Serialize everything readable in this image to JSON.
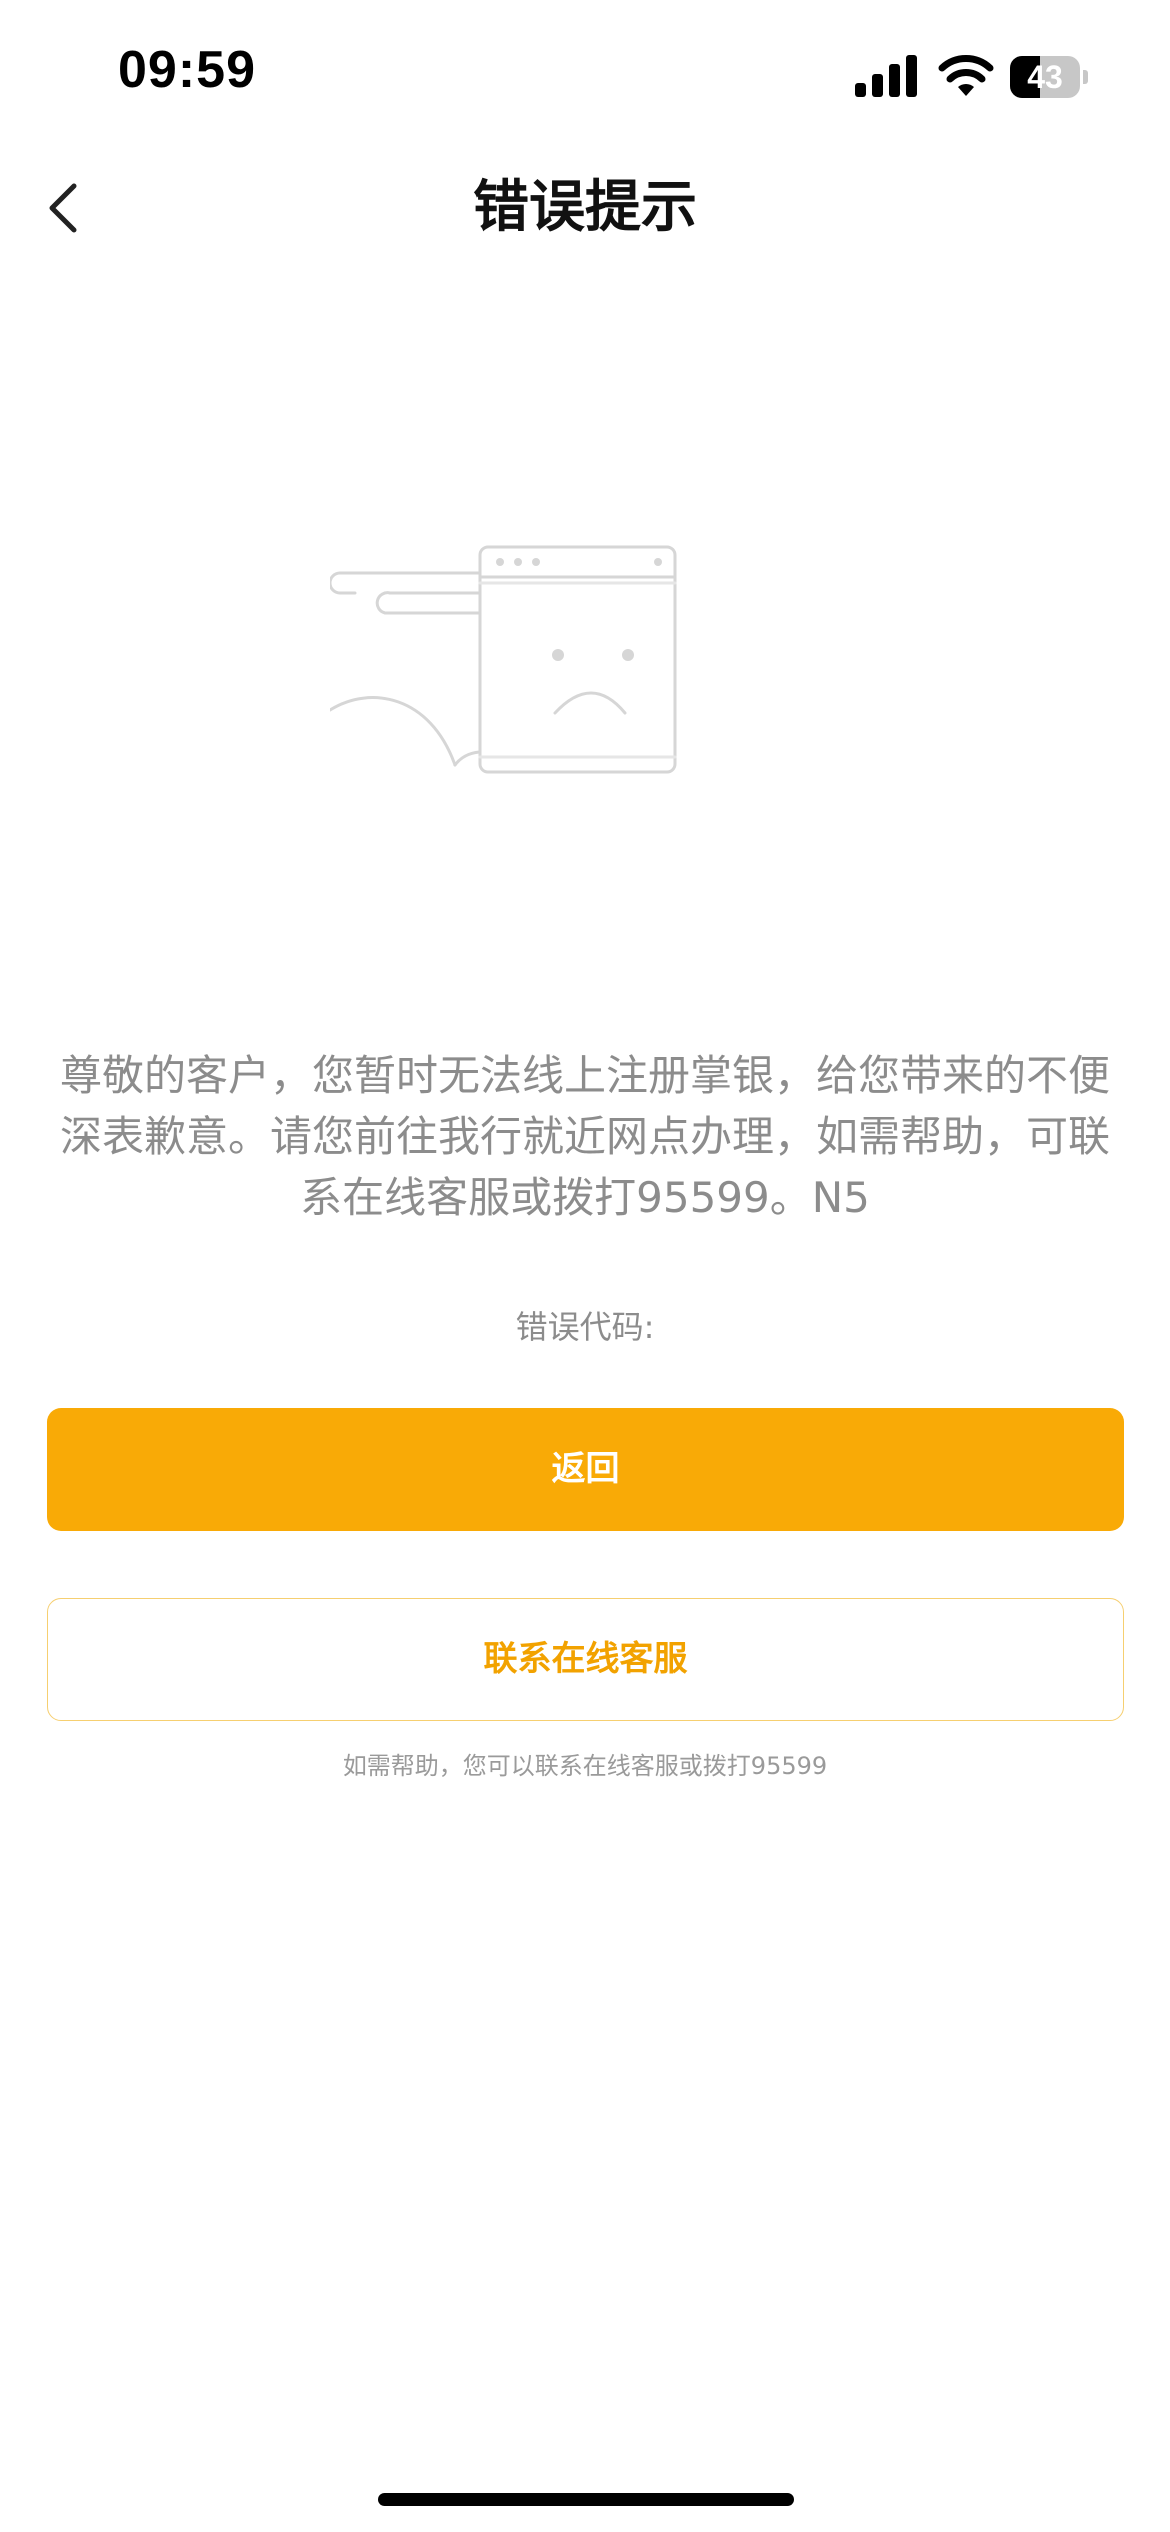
{
  "status_bar": {
    "time": "09:59",
    "battery_level": "43",
    "battery_percent": 43,
    "icons": [
      "cellular-signal-icon",
      "wifi-icon",
      "battery-icon"
    ]
  },
  "nav": {
    "title": "错误提示",
    "back_icon": "chevron-left-icon"
  },
  "illustration": {
    "icon": "sad-browser-window-illustration"
  },
  "error": {
    "message": "尊敬的客户，您暂时无法线上注册掌银，给您带来的不便深表歉意。请您前往我行就近网点办理，如需帮助，可联系在线客服或拨打95599。N5",
    "code_label": "错误代码:"
  },
  "actions": {
    "return_label": "返回",
    "contact_label": "联系在线客服"
  },
  "footer": {
    "help_text": "如需帮助，您可以联系在线客服或拨打95599"
  },
  "colors": {
    "primary": "#f9aa06",
    "primary_text": "#ffffff",
    "secondary_border": "#f6cf70",
    "secondary_text": "#f2a200",
    "message_text": "#8c8c8c"
  }
}
